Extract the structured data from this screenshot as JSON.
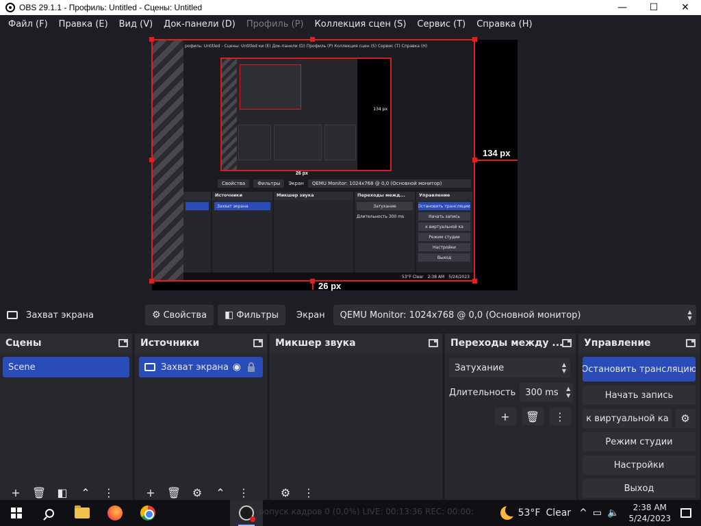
{
  "window": {
    "title": "OBS 29.1.1 - Профиль: Untitled - Сцены: Untitled",
    "minimize": "—",
    "maximize": "☐",
    "close": "✕"
  },
  "menu": [
    {
      "label": "Файл (F)",
      "enabled": true
    },
    {
      "label": "Правка (E)",
      "enabled": true
    },
    {
      "label": "Вид (V)",
      "enabled": true
    },
    {
      "label": "Док-панели (D)",
      "enabled": true
    },
    {
      "label": "Профиль (P)",
      "enabled": false
    },
    {
      "label": "Коллекция сцен (S)",
      "enabled": true
    },
    {
      "label": "Сервис (T)",
      "enabled": true
    },
    {
      "label": "Справка (H)",
      "enabled": true
    }
  ],
  "preview": {
    "right_px": "134 px",
    "bottom_px": "26 px",
    "inner_right_px": "134 px",
    "inner_bottom_px": "26 px",
    "inner_menu": "рофиль: Untitled - Сцены: Untitled   ки (E)  Док-панели (D)  Профиль (P)  Коллекция сцен (S)  Сервис (T)  Справка (H)",
    "inner_props_btn": "Свойства",
    "inner_filters_btn": "Фильтры",
    "inner_screen_label": "Экран",
    "inner_screen_value": "QEMU Monitor: 1024x768 @ 0,0 (Основной монитор)",
    "inner_sources_title": "Источники",
    "inner_source_item": "Захват экрана",
    "inner_mixer_title": "Микшер звука",
    "inner_trans_title": "Переходы межд...",
    "inner_trans_value": "Затухание",
    "inner_duration_label": "Длительность",
    "inner_duration_value": "300 ms",
    "inner_control_title": "Управление",
    "inner_ctrl_stop": "Остановить трансляцию",
    "inner_ctrl_record": "Начать запись",
    "inner_ctrl_virtual": "к виртуальной ка",
    "inner_ctrl_studio": "Режим студии",
    "inner_ctrl_settings": "Настройки",
    "inner_ctrl_exit": "Выход",
    "inner_weather": "53°F  Clear",
    "inner_time": "2:38 AM",
    "inner_date": "5/24/2023"
  },
  "properties_bar": {
    "source_name": "Захват экрана",
    "properties_btn": "Свойства",
    "filters_btn": "Фильтры",
    "screen_label": "Экран",
    "screen_value": "QEMU Monitor: 1024x768 @ 0,0 (Основной монитор)"
  },
  "scenes": {
    "title": "Сцены",
    "items": [
      "Scene"
    ]
  },
  "sources": {
    "title": "Источники",
    "items": [
      "Захват экрана"
    ]
  },
  "mixer": {
    "title": "Микшер звука"
  },
  "transitions": {
    "title": "Переходы между ...",
    "value": "Затухание",
    "duration_label": "Длительность",
    "duration_value": "300 ms"
  },
  "controls": {
    "title": "Управление",
    "stop_stream": "Остановить трансляцию",
    "start_record": "Начать запись",
    "virtual_cam": "к виртуальной ка",
    "studio_mode": "Режим студии",
    "settings": "Настройки",
    "exit": "Выход"
  },
  "status_ghost": "ропуск кадров 0 (0,0%)     LIVE: 00:13:36     REC: 00:00:",
  "taskbar": {
    "weather_temp": "53°F",
    "weather_text": "Clear",
    "time": "2:38 AM",
    "date": "5/24/2023"
  }
}
